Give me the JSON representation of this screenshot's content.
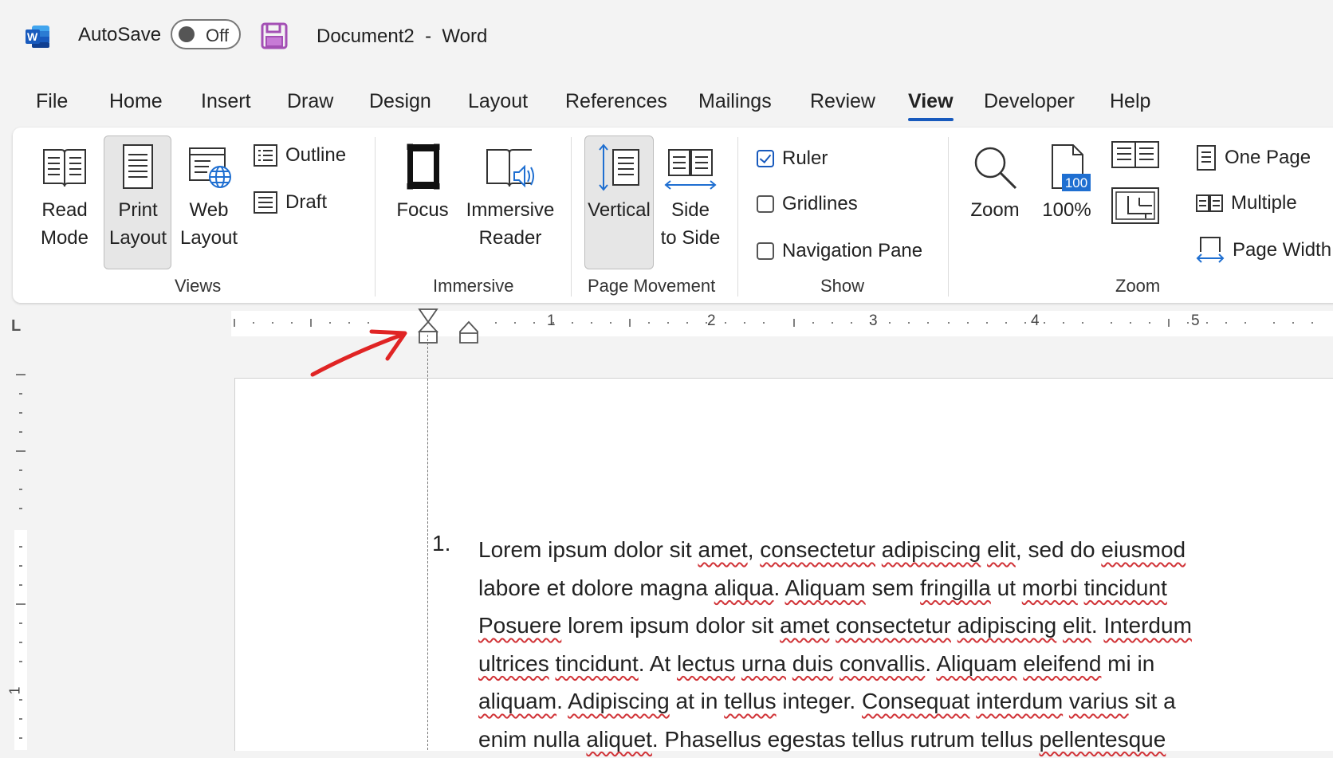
{
  "titlebar": {
    "autosave_label": "AutoSave",
    "autosave_state": "Off",
    "document_name": "Document2",
    "separator": "-",
    "app_name": "Word",
    "accent_color": "#185abd"
  },
  "tabs": [
    "File",
    "Home",
    "Insert",
    "Draw",
    "Design",
    "Layout",
    "References",
    "Mailings",
    "Review",
    "View",
    "Developer",
    "Help"
  ],
  "active_tab": "View",
  "ribbon": {
    "views": {
      "label": "Views",
      "read_mode": [
        "Read",
        "Mode"
      ],
      "print_layout": [
        "Print",
        "Layout"
      ],
      "web_layout": [
        "Web",
        "Layout"
      ],
      "outline": "Outline",
      "draft": "Draft",
      "selected": "Print Layout"
    },
    "immersive": {
      "label": "Immersive",
      "focus": "Focus",
      "reader": [
        "Immersive",
        "Reader"
      ]
    },
    "page_movement": {
      "label": "Page Movement",
      "vertical": "Vertical",
      "side": [
        "Side",
        "to Side"
      ],
      "selected": "Vertical"
    },
    "show": {
      "label": "Show",
      "ruler": {
        "label": "Ruler",
        "checked": true
      },
      "gridlines": {
        "label": "Gridlines",
        "checked": false
      },
      "navigation_pane": {
        "label": "Navigation Pane",
        "checked": false
      }
    },
    "zoom": {
      "label": "Zoom",
      "zoom_button": "Zoom",
      "hundred_badge": "100",
      "hundred_button": "100%",
      "one_page": "One Page",
      "multiple": "Multiple",
      "page_width": "Page Width"
    }
  },
  "ruler": {
    "tab_selector": "L",
    "numbers": [
      "1",
      "2",
      "3",
      "4",
      "5"
    ],
    "vertical_number": "1"
  },
  "document": {
    "list_number": "1.",
    "lines": [
      [
        "Lorem ipsum dolor sit ",
        "*amet",
        ", ",
        "*consectetur",
        " ",
        "*adipiscing",
        " ",
        "*elit",
        ", sed do ",
        "*eiusmod"
      ],
      [
        "labore et dolore magna ",
        "*aliqua",
        ". ",
        "*Aliquam",
        " sem ",
        "*fringilla",
        " ut ",
        "*morbi",
        " ",
        "*tincidunt"
      ],
      [
        "*Posuere",
        " lorem ipsum dolor sit ",
        "*amet",
        " ",
        "*consectetur",
        " ",
        "*adipiscing",
        " ",
        "*elit",
        ". ",
        "*Interdum"
      ],
      [
        "*ultrices",
        " ",
        "*tincidunt",
        ". At ",
        "*lectus",
        " ",
        "*urna",
        " ",
        "*duis",
        " ",
        "*convallis",
        ". ",
        "*Aliquam",
        " ",
        "*eleifend",
        " mi in"
      ],
      [
        "*aliquam",
        ". ",
        "*Adipiscing",
        " at in ",
        "*tellus",
        " integer. ",
        "*Consequat",
        " ",
        "*interdum",
        " ",
        "*varius",
        " sit a"
      ],
      [
        "enim nulla ",
        "*aliquet",
        ". Phasellus egestas tellus rutrum tellus ",
        "*pellentesque"
      ]
    ]
  },
  "annotation": {
    "arrow_color": "#e02424"
  }
}
